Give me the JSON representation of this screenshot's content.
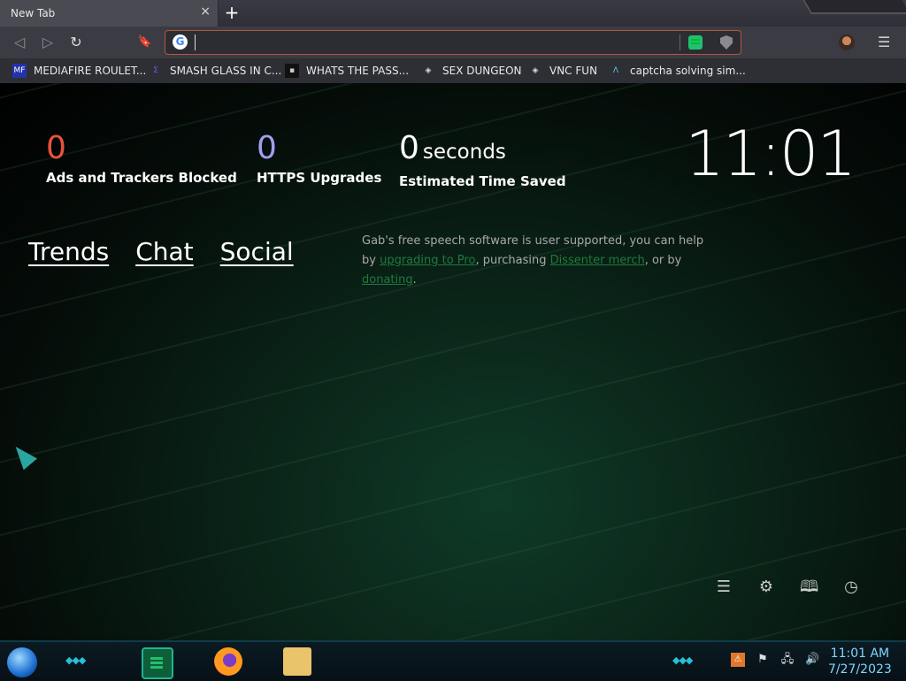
{
  "tab": {
    "title": "New Tab",
    "close": "×",
    "new_tab": "+"
  },
  "toolbar": {
    "back": "◁",
    "forward": "▷",
    "reload": "↻",
    "bookmark": "🔖",
    "url_value": "",
    "google_letter": "G",
    "menu": "☰"
  },
  "bookmarks": [
    {
      "label": "MEDIAFIRE ROULET...",
      "icon": "mediafire-icon",
      "glyph": "MF"
    },
    {
      "label": "SMASH GLASS IN C...",
      "icon": "glass-icon",
      "glyph": "Σ"
    },
    {
      "label": "WHATS THE PASS...",
      "icon": "terminal-icon",
      "glyph": "▪"
    },
    {
      "label": "SEX DUNGEON",
      "icon": "cube-icon",
      "glyph": "◈"
    },
    {
      "label": "VNC FUN",
      "icon": "cube-icon",
      "glyph": "◈"
    },
    {
      "label": "captcha solving sim...",
      "icon": "caret-icon",
      "glyph": "Λ"
    }
  ],
  "stats": {
    "ads": {
      "value": "0",
      "label": "Ads and Trackers Blocked",
      "color": "#e8533a"
    },
    "https": {
      "value": "0",
      "label": "HTTPS Upgrades",
      "color": "#a29ff0"
    },
    "time": {
      "value": "0",
      "unit": "seconds",
      "label": "Estimated Time Saved",
      "color": "#ffffff"
    }
  },
  "clock": "11:01",
  "links": [
    "Trends",
    "Chat",
    "Social"
  ],
  "gab": {
    "p1": "Gab's free speech software is user supported, you can help by ",
    "l1": "upgrading to Pro",
    "p2": ", purchasing ",
    "l2": "Dissenter merch",
    "p3": ", or by ",
    "l3": "donating",
    "p4": "."
  },
  "bottom_icons": [
    {
      "name": "customize-icon",
      "glyph": "☰"
    },
    {
      "name": "settings-icon",
      "glyph": "⚙"
    },
    {
      "name": "bookmarks-icon",
      "glyph": "🕮"
    },
    {
      "name": "history-icon",
      "glyph": "◷"
    }
  ],
  "taskbar": {
    "time": "11:01 AM",
    "date": "7/27/2023"
  },
  "tray": [
    "⚑",
    "🖧",
    "🔊"
  ]
}
